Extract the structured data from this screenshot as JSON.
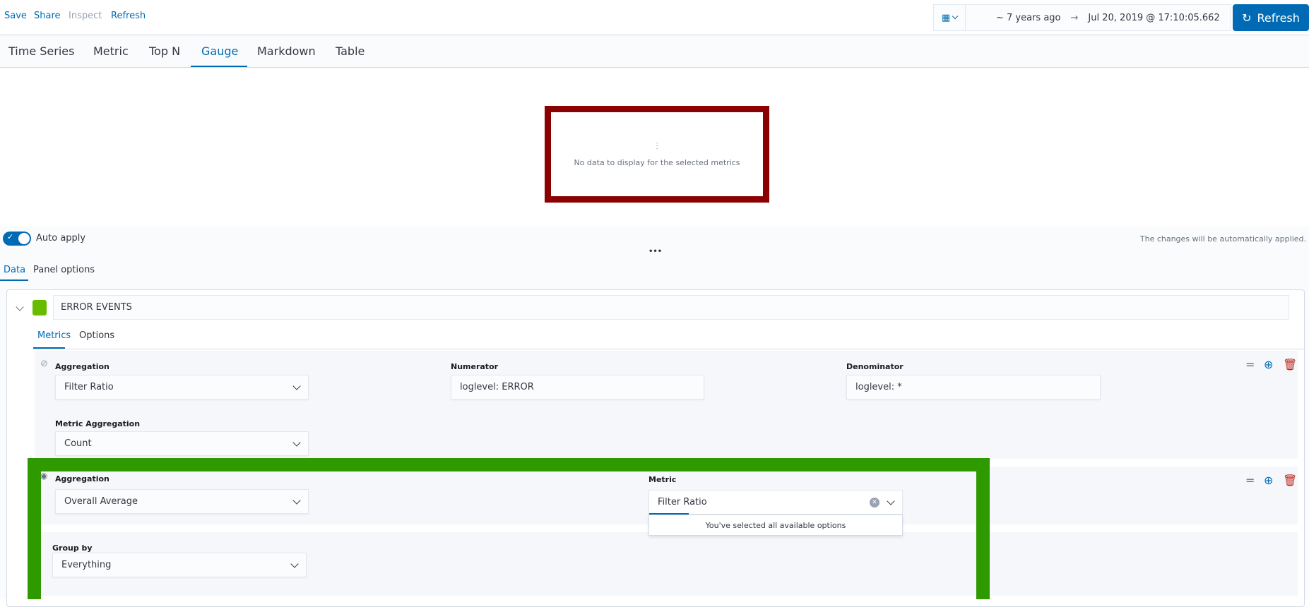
{
  "topnav": {
    "save": "Save",
    "share": "Share",
    "inspect": "Inspect",
    "refresh": "Refresh"
  },
  "timepicker": {
    "start": "~ 7 years ago",
    "arrow": "→",
    "end": "Jul 20, 2019 @ 17:10:05.662",
    "refresh_label": "Refresh"
  },
  "viz_tabs": [
    "Time Series",
    "Metric",
    "Top N",
    "Gauge",
    "Markdown",
    "Table"
  ],
  "preview": {
    "message": "No data to display for the selected metrics"
  },
  "editor": {
    "auto_apply": "Auto apply",
    "auto_msg": "The changes will be automatically applied.",
    "more": "•••",
    "tabs": [
      "Data",
      "Panel options"
    ]
  },
  "series": {
    "name": "ERROR EVENTS",
    "color": "#68bc00",
    "tabs": [
      "Metrics",
      "Options"
    ],
    "metric1": {
      "agg_label": "Aggregation",
      "agg_value": "Filter Ratio",
      "num_label": "Numerator",
      "num_value": "loglevel: ERROR",
      "den_label": "Denominator",
      "den_value": "loglevel: *",
      "metric_agg_label": "Metric Aggregation",
      "metric_agg_value": "Count"
    },
    "metric2": {
      "agg_label": "Aggregation",
      "agg_value": "Overall Average",
      "metric_label": "Metric",
      "metric_value": "Filter Ratio",
      "dropdown_msg": "You've selected all available options"
    },
    "group_by_label": "Group by",
    "group_by_value": "Everything"
  }
}
